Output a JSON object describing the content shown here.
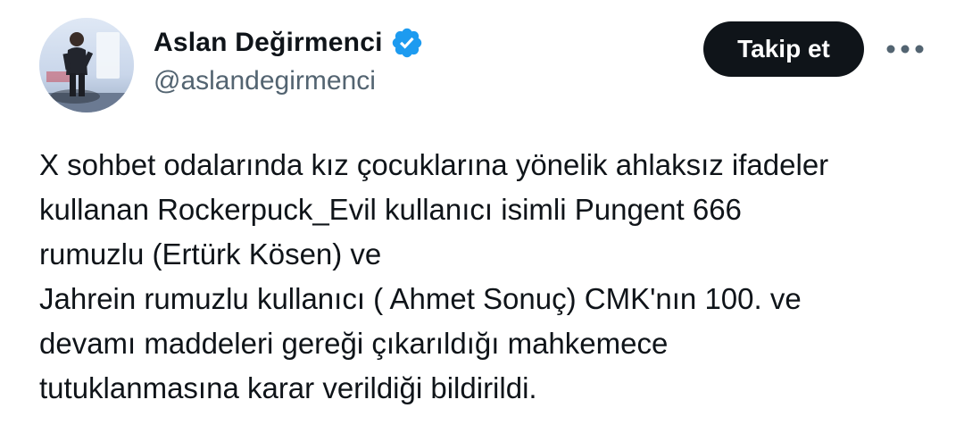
{
  "author": {
    "display_name": "Aslan Değirmenci",
    "handle": "@aslandegirmenci",
    "verified": true,
    "avatar": "profile-photo-speaker-on-stage"
  },
  "actions": {
    "follow_label": "Takip et",
    "more_icon": "more-horizontal-icon"
  },
  "tweet": {
    "lines": [
      "X sohbet odalarında kız çocuklarına yönelik ahlaksız ifadeler",
      "kullanan Rockerpuck_Evil kullanıcı isimli Pungent 666",
      "rumuzlu (Ertürk Kösen) ve",
      "Jahrein rumuzlu kullanıcı ( Ahmet Sonuç) CMK'nın 100. ve",
      "devamı maddeleri gereği çıkarıldığı mahkemece",
      "tutuklanmasına karar verildiği bildirildi."
    ]
  },
  "colors": {
    "verified_badge": "#1d9bf0",
    "button_bg": "#0f1419",
    "handle_text": "#536471"
  }
}
